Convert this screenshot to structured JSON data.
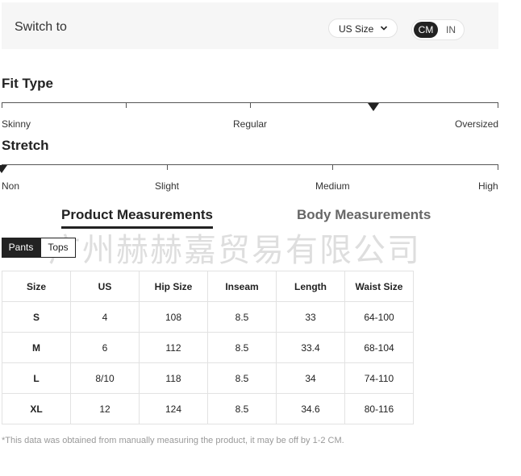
{
  "switch": {
    "label": "Switch to",
    "size_select": "US Size",
    "units": [
      "CM",
      "IN"
    ],
    "active_unit": "CM"
  },
  "fit_type": {
    "title": "Fit Type",
    "labels": [
      "Skinny",
      "Regular",
      "Oversized"
    ],
    "level": 0.75
  },
  "stretch": {
    "title": "Stretch",
    "labels": [
      "Non",
      "Slight",
      "Medium",
      "High"
    ],
    "level": 0
  },
  "measurement_tabs": {
    "product": "Product Measurements",
    "body": "Body Measurements",
    "active": "product"
  },
  "category": {
    "pants": "Pants",
    "tops": "Tops",
    "active": "pants"
  },
  "watermark": "广州赫赫嘉贸易有限公司",
  "table": {
    "headers": [
      "Size",
      "US",
      "Hip Size",
      "Inseam",
      "Length",
      "Waist Size"
    ],
    "rows": [
      [
        "S",
        "4",
        "108",
        "8.5",
        "33",
        "64-100"
      ],
      [
        "M",
        "6",
        "112",
        "8.5",
        "33.4",
        "68-104"
      ],
      [
        "L",
        "8/10",
        "118",
        "8.5",
        "34",
        "74-110"
      ],
      [
        "XL",
        "12",
        "124",
        "8.5",
        "34.6",
        "80-116"
      ]
    ]
  },
  "disclaimer": "*This data was obtained from manually measuring the product, it may be off by 1-2 CM."
}
